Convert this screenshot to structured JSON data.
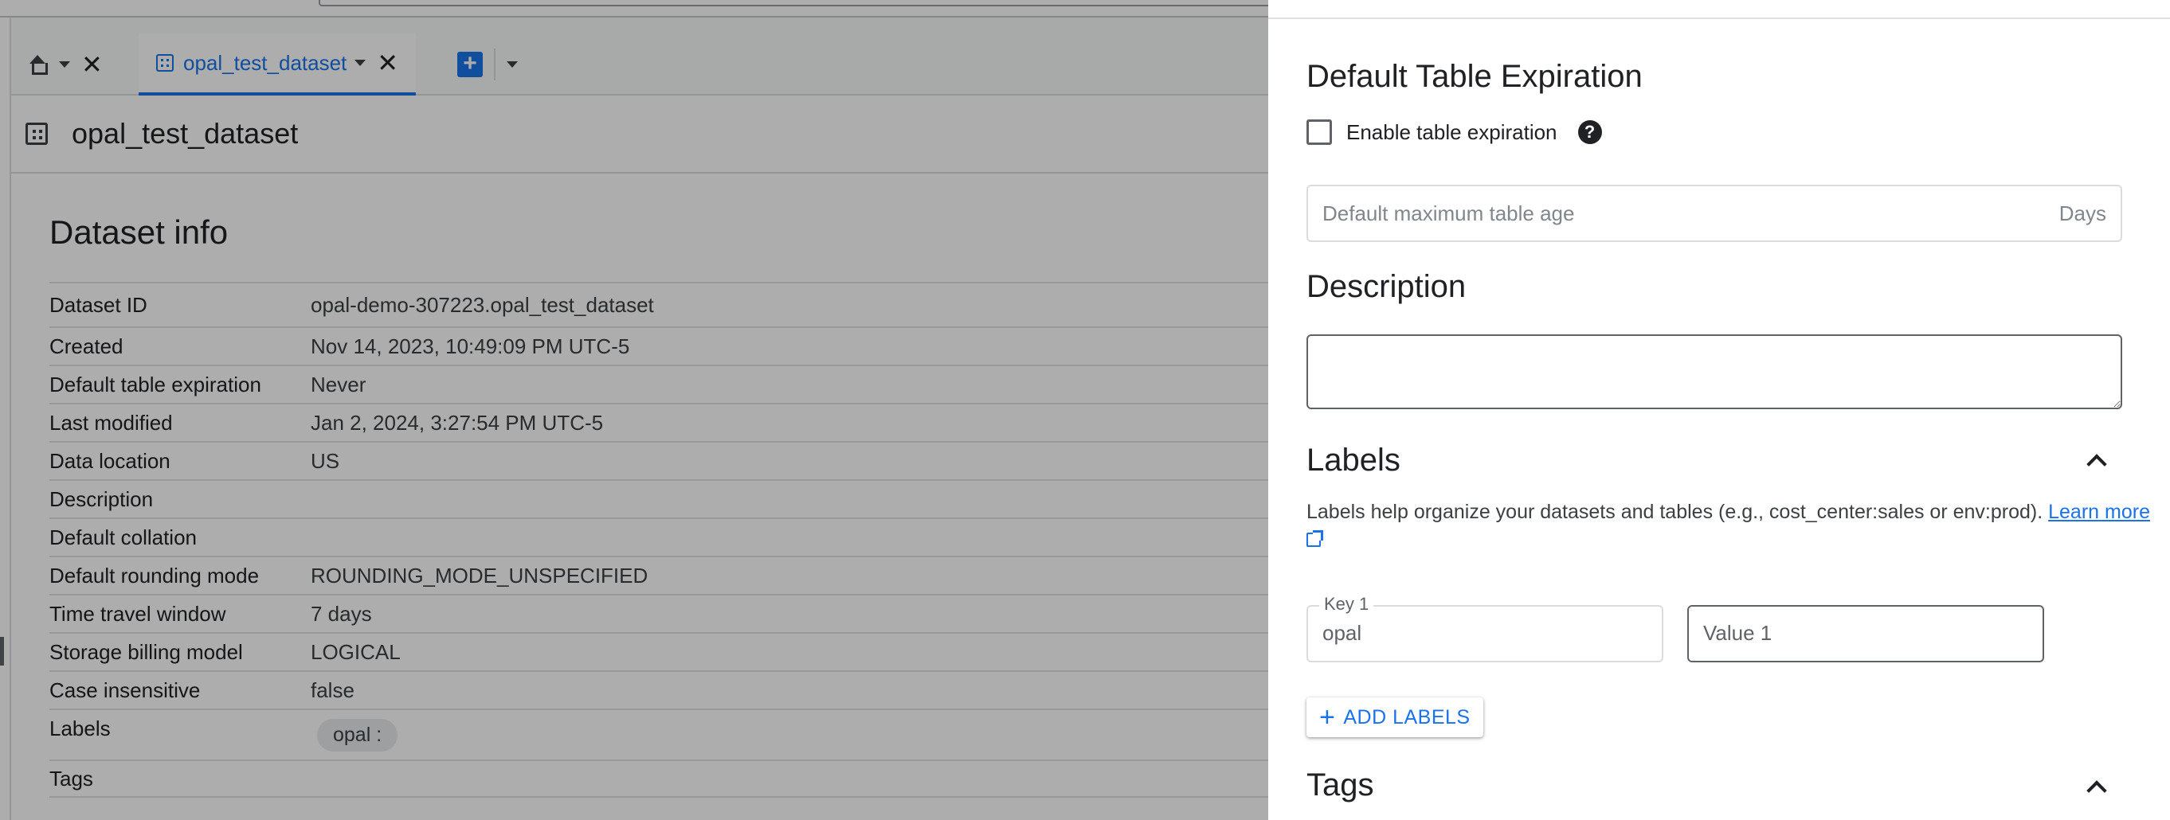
{
  "tabs": {
    "dataset_tab_label": "opal_test_dataset"
  },
  "page_title": "opal_test_dataset",
  "dataset_info": {
    "heading": "Dataset info",
    "rows": [
      {
        "key": "Dataset ID",
        "value": "opal-demo-307223.opal_test_dataset"
      },
      {
        "key": "Created",
        "value": "Nov 14, 2023, 10:49:09 PM UTC-5"
      },
      {
        "key": "Default table expiration",
        "value": "Never"
      },
      {
        "key": "Last modified",
        "value": "Jan 2, 2024, 3:27:54 PM UTC-5"
      },
      {
        "key": "Data location",
        "value": "US"
      },
      {
        "key": "Description",
        "value": ""
      },
      {
        "key": "Default collation",
        "value": ""
      },
      {
        "key": "Default rounding mode",
        "value": "ROUNDING_MODE_UNSPECIFIED"
      },
      {
        "key": "Time travel window",
        "value": "7 days"
      },
      {
        "key": "Storage billing model",
        "value": "LOGICAL"
      },
      {
        "key": "Case insensitive",
        "value": "false"
      },
      {
        "key": "Labels",
        "chip": "opal :"
      },
      {
        "key": "Tags",
        "value": ""
      }
    ]
  },
  "panel": {
    "expiration_heading": "Default Table Expiration",
    "enable_expiration_label": "Enable table expiration",
    "enable_expiration_checked": false,
    "max_age_placeholder": "Default maximum table age",
    "max_age_suffix": "Days",
    "description_heading": "Description",
    "description_value": "",
    "labels_heading": "Labels",
    "labels_help_text": "Labels help organize your datasets and tables (e.g., cost_center:sales or env:prod).",
    "learn_more": "Learn more",
    "key_label": "Key 1",
    "key_value": "opal",
    "value_placeholder": "Value 1",
    "add_labels_button": "ADD LABELS",
    "tags_heading": "Tags"
  },
  "icons": {
    "home": "home-icon",
    "dataset": "dataset-grid-icon",
    "close": "close-icon",
    "add_tab": "add-tab-icon",
    "help": "help-icon",
    "collapse": "chevron-up-icon",
    "external_link": "open-in-new-icon",
    "plus": "plus-icon"
  },
  "colors": {
    "accent": "#1a73e8",
    "overlay": "rgba(0,0,0,0.32)",
    "text": "#202124"
  }
}
